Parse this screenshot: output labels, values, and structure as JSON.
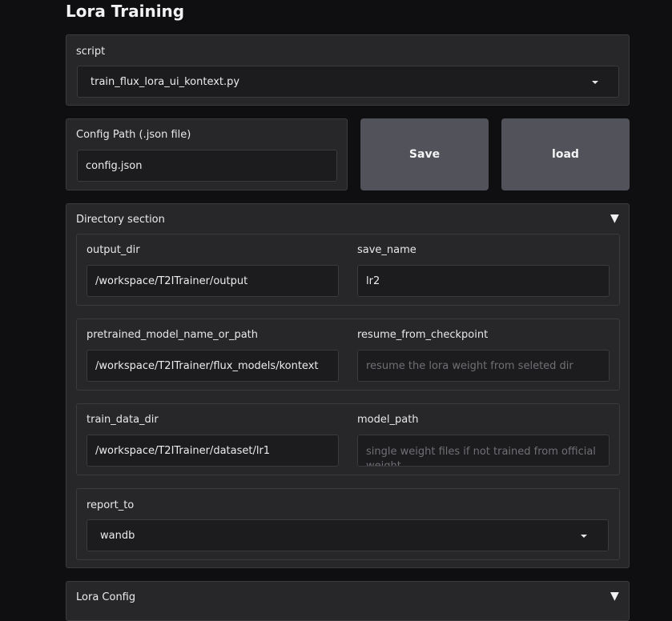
{
  "page": {
    "title": "Lora Training"
  },
  "script": {
    "label": "script",
    "selected": "train_flux_lora_ui_kontext.py"
  },
  "config": {
    "label": "Config Path (.json file)",
    "value": "config.json",
    "save_label": "Save",
    "load_label": "load"
  },
  "directory": {
    "title": "Directory section",
    "toggle": "▼",
    "output_dir": {
      "label": "output_dir",
      "value": "/workspace/T2ITrainer/output"
    },
    "save_name": {
      "label": "save_name",
      "value": "lr2"
    },
    "pretrained": {
      "label": "pretrained_model_name_or_path",
      "value": "/workspace/T2ITrainer/flux_models/kontext"
    },
    "resume": {
      "label": "resume_from_checkpoint",
      "placeholder": "resume the lora weight from seleted dir"
    },
    "train_data_dir": {
      "label": "train_data_dir",
      "value": "/workspace/T2ITrainer/dataset/lr1"
    },
    "model_path": {
      "label": "model_path",
      "placeholder": "single weight files if not trained from official weight"
    },
    "report_to": {
      "label": "report_to",
      "selected": "wandb"
    }
  },
  "lora_config": {
    "title": "Lora Config",
    "toggle": "▼"
  }
}
